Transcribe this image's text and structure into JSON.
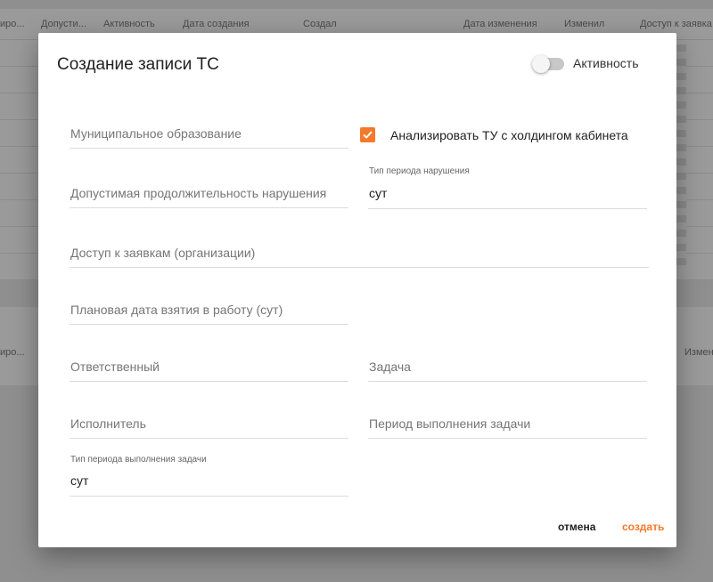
{
  "background": {
    "columns": [
      "иро...",
      "Допусти...",
      "Активность",
      "Дата создания",
      "Создал",
      "Дата изменения",
      "Изменил",
      "Доступ к заявка"
    ],
    "panel2_cells": [
      "иро...",
      "Измен"
    ]
  },
  "modal": {
    "title": "Создание записи ТС",
    "active_toggle": {
      "label": "Активность",
      "on": false
    },
    "fields": {
      "municipality": {
        "placeholder": "Муниципальное образование"
      },
      "analyze_checkbox": {
        "label": "Анализировать ТУ с холдингом кабинета",
        "checked": true
      },
      "violation_duration": {
        "placeholder": "Допустимая продолжительность нарушения"
      },
      "violation_period_type": {
        "label": "Тип периода нарушения",
        "value": "сут"
      },
      "access_orgs": {
        "placeholder": "Доступ к заявкам (организации)"
      },
      "planned_date": {
        "placeholder": "Плановая дата взятия в работу (сут)"
      },
      "responsible": {
        "placeholder": "Ответственный"
      },
      "task": {
        "placeholder": "Задача"
      },
      "executor": {
        "placeholder": "Исполнитель"
      },
      "task_period": {
        "placeholder": "Период выполнения задачи"
      },
      "task_period_type": {
        "label": "Тип периода выполнения задачи",
        "value": "сут"
      }
    },
    "buttons": {
      "cancel": "отмена",
      "create": "создать"
    }
  },
  "colors": {
    "accent": "#f5792a",
    "overlay": "#8f8f8f"
  }
}
